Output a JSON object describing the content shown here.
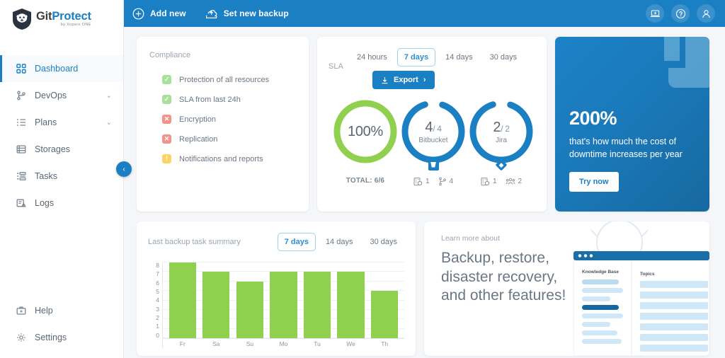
{
  "brand": {
    "title_a": "Git",
    "title_b": "Protect",
    "subtitle": "by Xopero ONE",
    "logo_icon": "shield-bear-logo"
  },
  "topbar": {
    "actions": [
      {
        "label": "Add new",
        "icon": "plus-circle-icon"
      },
      {
        "label": "Set new backup",
        "icon": "cloud-upload-icon"
      }
    ],
    "right_icons": [
      {
        "name": "laptop-plus-icon"
      },
      {
        "name": "help-circle-icon"
      },
      {
        "name": "user-account-icon"
      }
    ]
  },
  "sidebar": {
    "items": [
      {
        "label": "Dashboard",
        "icon": "grid-icon",
        "active": true,
        "chevron": ""
      },
      {
        "label": "DevOps",
        "icon": "branch-icon",
        "active": false,
        "chevron": "⌄"
      },
      {
        "label": "Plans",
        "icon": "list-icon",
        "active": false,
        "chevron": "⌄"
      },
      {
        "label": "Storages",
        "icon": "database-icon",
        "active": false,
        "chevron": ""
      },
      {
        "label": "Tasks",
        "icon": "tasks-icon",
        "active": false,
        "chevron": ""
      },
      {
        "label": "Logs",
        "icon": "logs-icon",
        "active": false,
        "chevron": ""
      }
    ],
    "bottom_items": [
      {
        "label": "Help",
        "icon": "help-kit-icon"
      },
      {
        "label": "Settings",
        "icon": "gear-icon"
      }
    ],
    "collapse_icon": "chevron-left-icon"
  },
  "compliance": {
    "label": "Compliance",
    "items": [
      {
        "text": "Protection of all resources",
        "status": "ok",
        "glyph": "✓"
      },
      {
        "text": "SLA from last 24h",
        "status": "ok",
        "glyph": "✓"
      },
      {
        "text": "Encryption",
        "status": "err",
        "glyph": "✕"
      },
      {
        "text": "Replication",
        "status": "err",
        "glyph": "✕"
      },
      {
        "text": "Notifications and reports",
        "status": "warn",
        "glyph": "!"
      }
    ]
  },
  "sla": {
    "label": "SLA",
    "filters": [
      {
        "label": "24 hours",
        "selected": false
      },
      {
        "label": "7 days",
        "selected": true
      },
      {
        "label": "14 days",
        "selected": false
      },
      {
        "label": "30 days",
        "selected": false
      }
    ],
    "export_label": "Export",
    "export_icon": "download-icon",
    "export_chevron": "›",
    "total_label": "TOTAL: 6/6",
    "gauges": [
      {
        "id": "overall",
        "main": "100%",
        "secondary": "",
        "sub": "",
        "percent": 100,
        "color": "#8fd14f",
        "badge": "none",
        "stats": []
      },
      {
        "id": "bitbucket",
        "main": "4",
        "secondary": "/ 4",
        "sub": "Bitbucket",
        "percent": 100,
        "color": "#1b7fc4",
        "badge": "bitbucket-icon",
        "stats": [
          {
            "icon": "org-shield-icon",
            "value": "1"
          },
          {
            "icon": "branch-icon",
            "value": "4"
          }
        ]
      },
      {
        "id": "jira",
        "main": "2",
        "secondary": "/ 2",
        "sub": "Jira",
        "percent": 100,
        "color": "#1b7fc4",
        "badge": "jira-icon",
        "stats": [
          {
            "icon": "org-shield-icon",
            "value": "1"
          },
          {
            "icon": "users-icon",
            "value": "2"
          }
        ]
      }
    ]
  },
  "promo": {
    "headline": "200%",
    "description": "that's how much the cost of downtime increases per year",
    "button_label": "Try now",
    "background_color": "#1b7fc4"
  },
  "chart_card": {
    "title": "Last backup task summary",
    "filters": [
      {
        "label": "7 days",
        "selected": true
      },
      {
        "label": "14 days",
        "selected": false
      },
      {
        "label": "30 days",
        "selected": false
      }
    ]
  },
  "chart_data": {
    "type": "bar",
    "title": "Last backup task summary",
    "categories": [
      "Fr",
      "Sa",
      "Su",
      "Mo",
      "Tu",
      "We",
      "Th"
    ],
    "values": [
      8,
      7,
      6,
      7,
      7,
      7,
      5
    ],
    "yticks": [
      0,
      1,
      2,
      3,
      4,
      5,
      6,
      7,
      8
    ],
    "ylim": [
      0,
      8
    ],
    "xlabel": "",
    "ylabel": "",
    "grid": true,
    "legend": "none",
    "bar_color": "#8fd14f"
  },
  "learn": {
    "subtitle": "Learn more about",
    "title": "Backup, restore, disaster recovery, and other features!",
    "art": {
      "window_label": "Knowledge Base",
      "column_label": "Topics",
      "icon": "lightbulb-icon"
    }
  }
}
